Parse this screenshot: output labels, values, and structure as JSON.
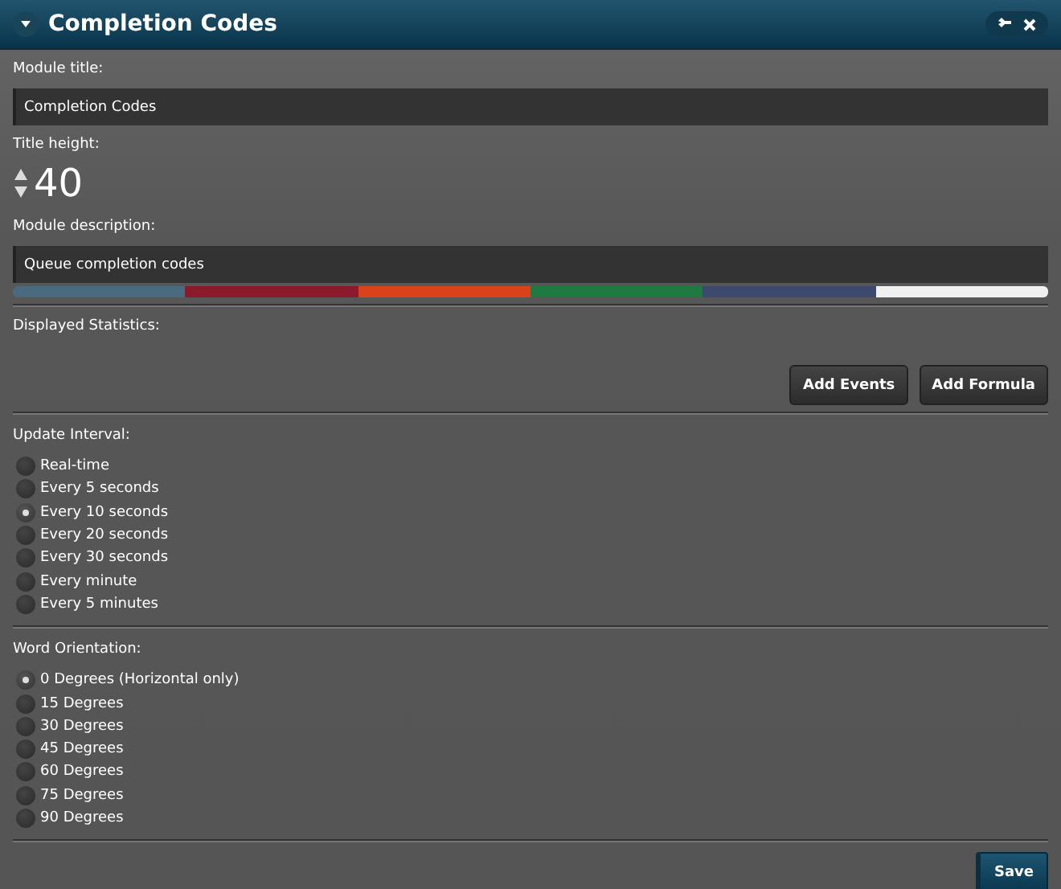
{
  "window": {
    "title": "Completion Codes"
  },
  "module_title": {
    "label": "Module title:",
    "value": "Completion Codes"
  },
  "title_height": {
    "label": "Title height:",
    "value": "40"
  },
  "module_description": {
    "label": "Module description:",
    "value": "Queue completion codes"
  },
  "color_palette": [
    {
      "color": "#4a6a80"
    },
    {
      "color": "#8b1a2a"
    },
    {
      "color": "#d9421b"
    },
    {
      "color": "#1e7a40"
    },
    {
      "color": "#3d4a6e"
    },
    {
      "color": "#f0f0f0"
    }
  ],
  "displayed_statistics": {
    "label": "Displayed Statistics:",
    "buttons": [
      "Add Events",
      "Add Formula"
    ]
  },
  "update_interval": {
    "label": "Update Interval:",
    "options": [
      {
        "label": "Real-time",
        "selected": false
      },
      {
        "label": "Every 5 seconds",
        "selected": false
      },
      {
        "label": "Every 10 seconds",
        "selected": true
      },
      {
        "label": "Every 20 seconds",
        "selected": false
      },
      {
        "label": "Every 30 seconds",
        "selected": false
      },
      {
        "label": "Every minute",
        "selected": false
      },
      {
        "label": "Every 5 minutes",
        "selected": false
      }
    ]
  },
  "word_orientation": {
    "label": "Word Orientation:",
    "options": [
      {
        "label": "0 Degrees (Horizontal only)",
        "selected": true
      },
      {
        "label": "15 Degrees",
        "selected": false
      },
      {
        "label": "30 Degrees",
        "selected": false
      },
      {
        "label": "45 Degrees",
        "selected": false
      },
      {
        "label": "60 Degrees",
        "selected": false
      },
      {
        "label": "75 Degrees",
        "selected": false
      },
      {
        "label": "90 Degrees",
        "selected": false
      }
    ]
  },
  "save_button": "Save"
}
